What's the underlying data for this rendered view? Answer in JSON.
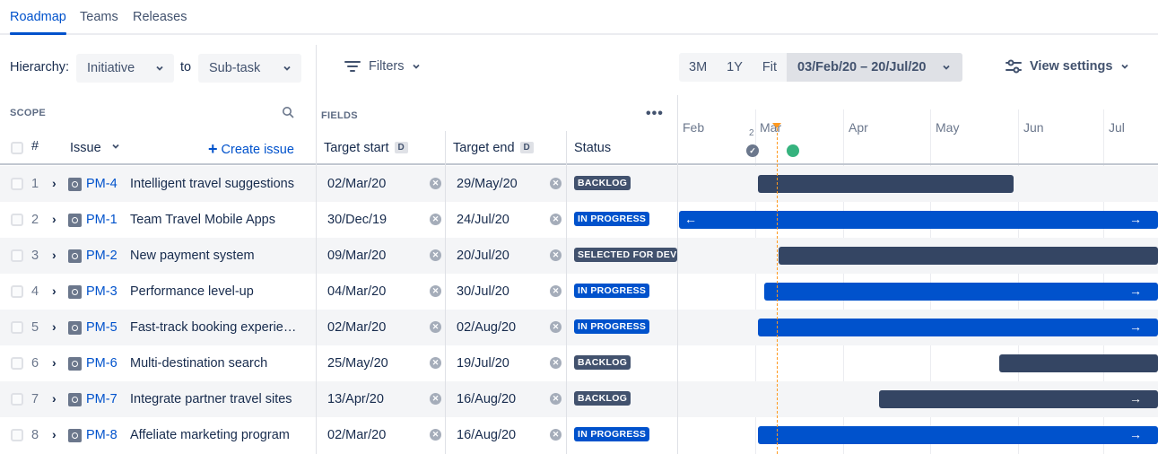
{
  "tabs": [
    {
      "label": "Roadmap",
      "active": true
    },
    {
      "label": "Teams",
      "active": false
    },
    {
      "label": "Releases",
      "active": false
    }
  ],
  "toolbar": {
    "hierarchy_label": "Hierarchy:",
    "hierarchy_from": "Initiative",
    "to_label": "to",
    "hierarchy_to": "Sub-task",
    "filters_label": "Filters",
    "range_options": [
      "3M",
      "1Y",
      "Fit"
    ],
    "date_range": "03/Feb/20 – 20/Jul/20",
    "view_settings_label": "View settings"
  },
  "headers": {
    "scope": "SCOPE",
    "fields": "FIELDS",
    "num": "#",
    "issue": "Issue",
    "create_issue": "Create issue",
    "target_start": "Target start",
    "target_end": "Target end",
    "date_badge": "D",
    "status": "Status"
  },
  "timeline": {
    "months": [
      "Feb",
      "Mar",
      "Apr",
      "May",
      "Jun",
      "Jul"
    ],
    "release_count": "2"
  },
  "colors": {
    "accent": "#0052CC",
    "backlog": "#42526E",
    "in_progress": "#0052CC",
    "bar_dark": "#344563",
    "bar_blue": "#0052CC",
    "today": "#FF991F",
    "release_green": "#36B37E"
  },
  "rows": [
    {
      "num": "1",
      "key": "PM-4",
      "summary": "Intelligent travel suggestions",
      "start": "02/Mar/20",
      "end": "29/May/20",
      "status": "BACKLOG"
    },
    {
      "num": "2",
      "key": "PM-1",
      "summary": "Team Travel Mobile Apps",
      "start": "30/Dec/19",
      "end": "24/Jul/20",
      "status": "IN PROGRESS"
    },
    {
      "num": "3",
      "key": "PM-2",
      "summary": "New payment system",
      "start": "09/Mar/20",
      "end": "20/Jul/20",
      "status": "SELECTED FOR DEVELOPMENT"
    },
    {
      "num": "4",
      "key": "PM-3",
      "summary": "Performance level-up",
      "start": "04/Mar/20",
      "end": "30/Jul/20",
      "status": "IN PROGRESS"
    },
    {
      "num": "5",
      "key": "PM-5",
      "summary": "Fast-track booking experie…",
      "start": "02/Mar/20",
      "end": "02/Aug/20",
      "status": "IN PROGRESS"
    },
    {
      "num": "6",
      "key": "PM-6",
      "summary": "Multi-destination search",
      "start": "25/May/20",
      "end": "19/Jul/20",
      "status": "BACKLOG"
    },
    {
      "num": "7",
      "key": "PM-7",
      "summary": "Integrate partner travel sites",
      "start": "13/Apr/20",
      "end": "16/Aug/20",
      "status": "BACKLOG"
    },
    {
      "num": "8",
      "key": "PM-8",
      "summary": "Affeliate marketing program",
      "start": "02/Mar/20",
      "end": "16/Aug/20",
      "status": "IN PROGRESS"
    }
  ]
}
